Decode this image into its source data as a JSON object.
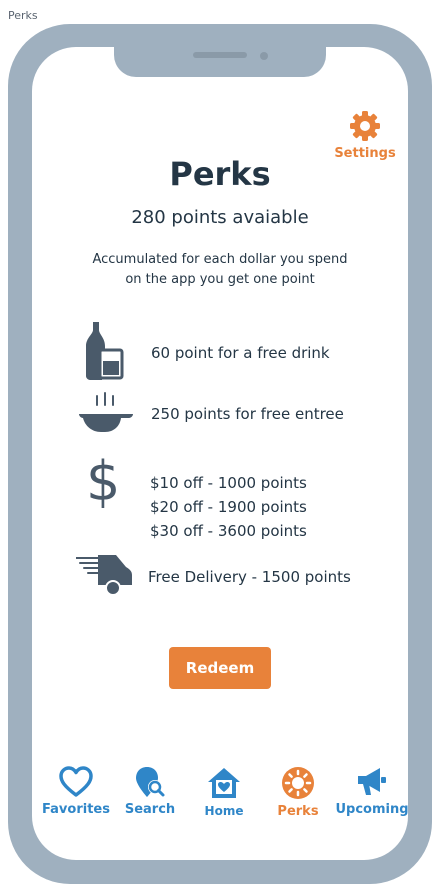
{
  "page_label": "Perks",
  "header": {
    "settings_label": "Settings"
  },
  "main": {
    "title": "Perks",
    "points_text": "280 points avaiable",
    "description_line1": "Accumulated for each dollar you spend",
    "description_line2": "on the app you get one point",
    "perks": [
      {
        "icon": "drink-icon",
        "lines": [
          "60 point for a free drink"
        ]
      },
      {
        "icon": "entree-pan-icon",
        "lines": [
          "250 points for free entree"
        ]
      },
      {
        "icon": "dollar-icon",
        "lines": [
          "$10 off - 1000 points",
          "$20 off - 1900 points",
          "$30 off - 3600 points"
        ]
      },
      {
        "icon": "delivery-truck-icon",
        "lines": [
          "Free Delivery - 1500 points"
        ]
      }
    ],
    "redeem_label": "Redeem"
  },
  "tabbar": {
    "items": [
      {
        "label": "Favorites",
        "icon": "heart-icon",
        "active": false
      },
      {
        "label": "Search",
        "icon": "map-search-icon",
        "active": false
      },
      {
        "label": "Home",
        "icon": "home-icon",
        "active": false
      },
      {
        "label": "Perks",
        "icon": "perks-badge-icon",
        "active": true
      },
      {
        "label": "Upcoming",
        "icon": "megaphone-icon",
        "active": false
      }
    ]
  },
  "colors": {
    "accent": "#e8823a",
    "tab_blue": "#2f86c8",
    "text_dark": "#243645",
    "icon_gray": "#4a5a6a",
    "frame": "#9fb0bf"
  }
}
